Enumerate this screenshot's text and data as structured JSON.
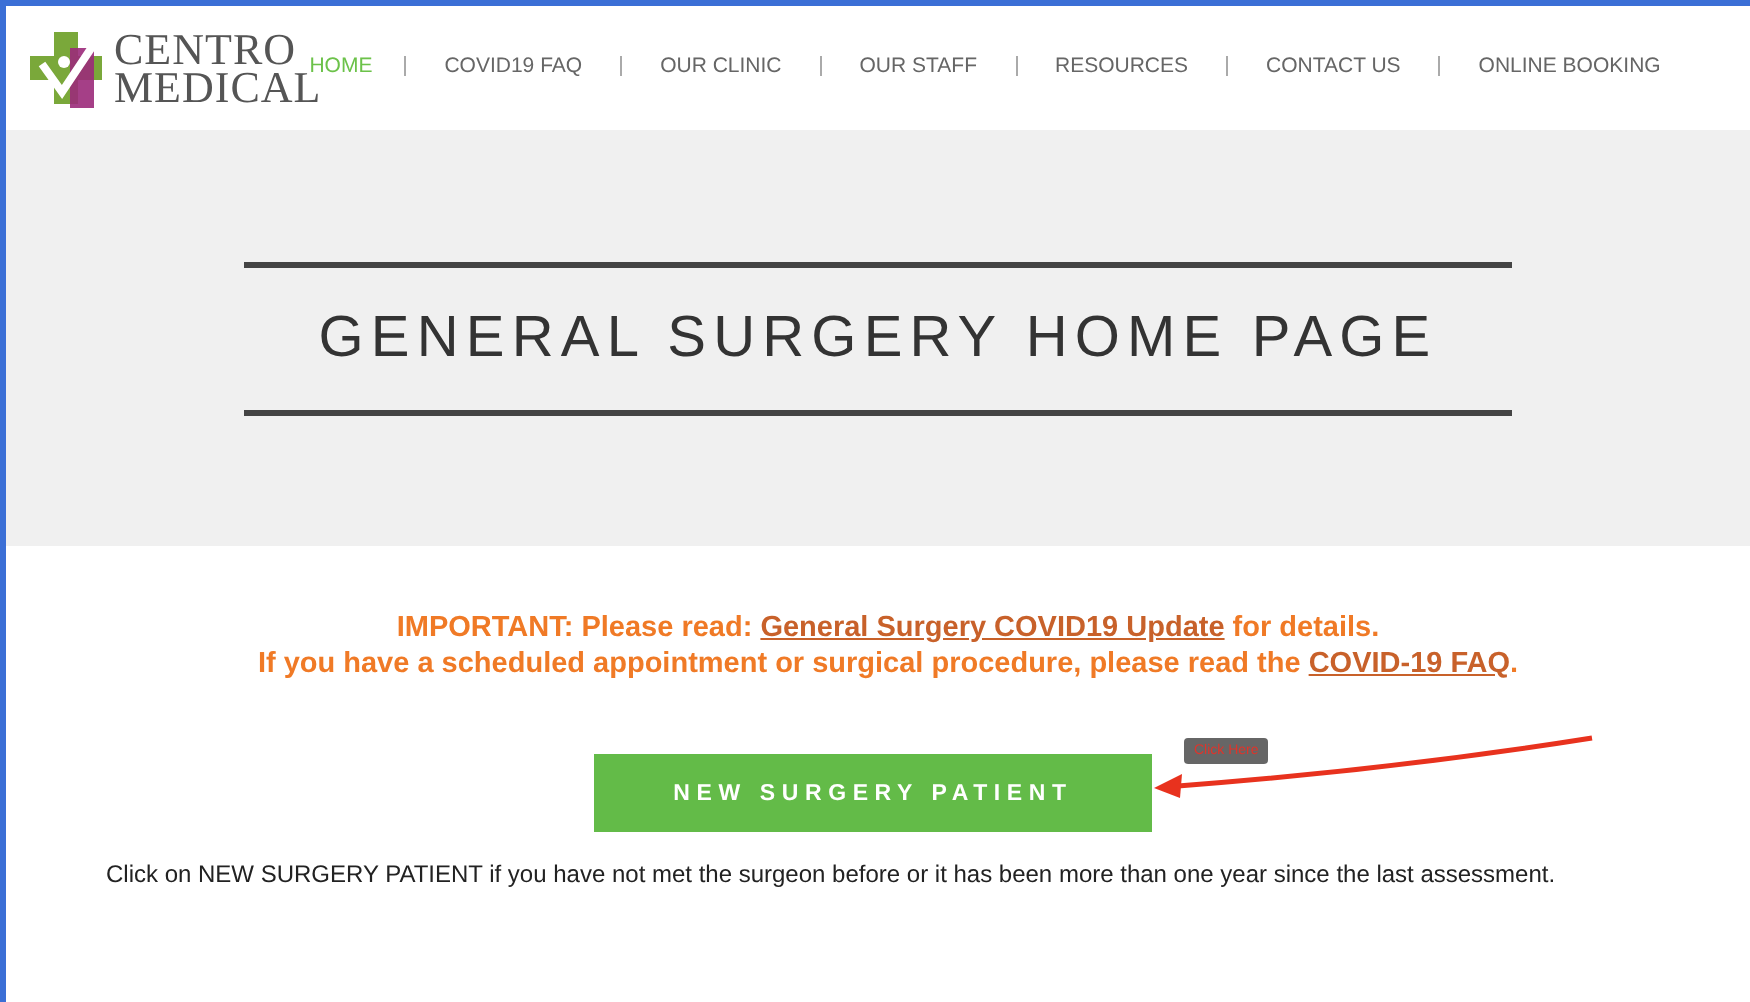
{
  "logo": {
    "line1": "CENTRO",
    "line2": "MEDICAL"
  },
  "nav": [
    {
      "label": "HOME",
      "selected": true
    },
    {
      "label": "COVID19 FAQ",
      "selected": false
    },
    {
      "label": "OUR CLINIC",
      "selected": false
    },
    {
      "label": "OUR STAFF",
      "selected": false
    },
    {
      "label": "RESOURCES",
      "selected": false
    },
    {
      "label": "CONTACT US",
      "selected": false
    },
    {
      "label": "ONLINE BOOKING",
      "selected": false
    }
  ],
  "hero": {
    "title": "GENERAL SURGERY HOME PAGE"
  },
  "notices": [
    {
      "before": "IMPORTANT: Please read: ",
      "link": "General Surgery COVID19 Update",
      "after": " for details."
    },
    {
      "before": "If you have a scheduled appointment or surgical procedure, please read the ",
      "link": "COVID-19 FAQ",
      "after": "."
    }
  ],
  "cta": {
    "label": "NEW SURGERY PATIENT",
    "tooltip": "Click Here"
  },
  "description": "Click on NEW SURGERY PATIENT if you have not met the surgeon before or it has been more than one year since the last assessment."
}
